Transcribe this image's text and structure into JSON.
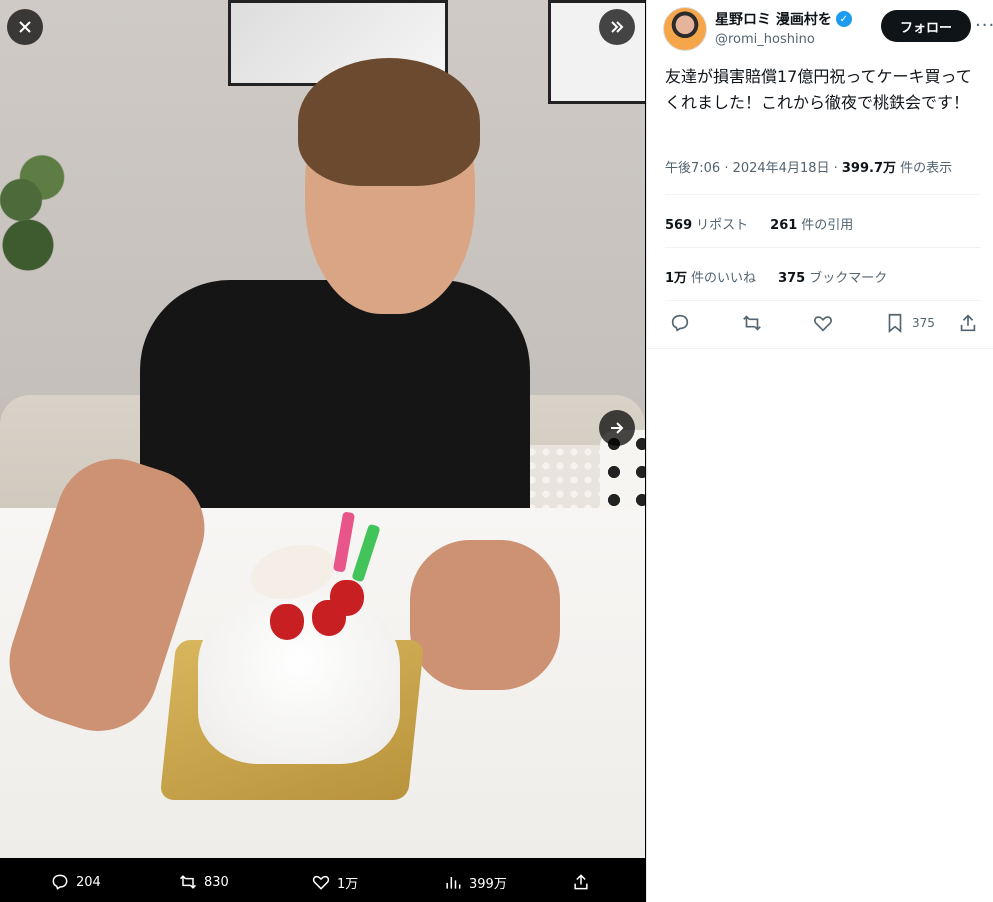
{
  "media": {
    "stats": {
      "replies": "204",
      "reposts": "830",
      "likes": "1万",
      "views": "399万"
    }
  },
  "tweet": {
    "display_name": "星野ロミ 漫画村を",
    "handle": "@romi_hoshino",
    "follow_label": "フォロー",
    "more_label": "···",
    "text": "友達が損害賠償17億円祝ってケーキ買ってくれました！これから徹夜で桃鉄会です！",
    "time": "午後7:06 · 2024年4月18日 · ",
    "views_count": "399.7万",
    "views_label": " 件の表示",
    "reposts_count": "569",
    "reposts_label": "リポスト",
    "quotes_count": "261",
    "quotes_label": "件の引用",
    "likes_count": "1万",
    "likes_label": "件のいいね",
    "bookmarks_count": "375",
    "bookmarks_label": "ブックマーク",
    "bookmark_action_count": "375"
  },
  "colors": {
    "accent": "#1d9bf0",
    "text": "#0f1419",
    "muted": "#536471"
  }
}
